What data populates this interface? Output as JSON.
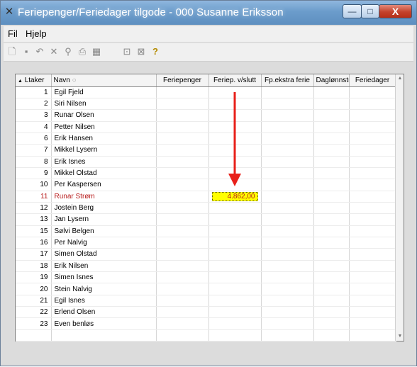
{
  "window": {
    "title": "Feriepenger/Feriedager tilgode - 000 Susanne Eriksson",
    "minimize": "—",
    "maximize": "□",
    "close": "X"
  },
  "menu": {
    "file": "Fil",
    "help": "Hjelp"
  },
  "toolbar": {
    "icons": [
      "new-icon",
      "save-icon",
      "undo-icon",
      "delete-icon",
      "find-icon",
      "print-icon",
      "calculator-icon",
      "export-icon",
      "excel-icon",
      "help-icon"
    ],
    "help_glyph": "?"
  },
  "grid": {
    "columns": [
      "Ltaker",
      "Navn",
      "Feriepenger",
      "Feriep. v/slutt",
      "Fp.ekstra ferie",
      "Daglønnstr",
      "Feriedager"
    ],
    "sort_indicator": "▲",
    "rows": [
      {
        "nr": "1",
        "name": "Egil Fjeld"
      },
      {
        "nr": "2",
        "name": "Siri Nilsen"
      },
      {
        "nr": "3",
        "name": "Runar Olsen"
      },
      {
        "nr": "4",
        "name": "Petter Nilsen"
      },
      {
        "nr": "6",
        "name": "Erik Hansen"
      },
      {
        "nr": "7",
        "name": "Mikkel Lysern"
      },
      {
        "nr": "8",
        "name": "Erik Isnes"
      },
      {
        "nr": "9",
        "name": "Mikkel Olstad"
      },
      {
        "nr": "10",
        "name": "Per Kaspersen"
      },
      {
        "nr": "11",
        "name": "Runar Strøm",
        "feriep_slutt": "4.862,00"
      },
      {
        "nr": "12",
        "name": "Jostein Berg"
      },
      {
        "nr": "13",
        "name": "Jan Lysern"
      },
      {
        "nr": "15",
        "name": "Sølvi Belgen"
      },
      {
        "nr": "16",
        "name": "Per Nalvig"
      },
      {
        "nr": "17",
        "name": "Simen Olstad"
      },
      {
        "nr": "18",
        "name": "Erik Nilsen"
      },
      {
        "nr": "19",
        "name": "Simen Isnes"
      },
      {
        "nr": "20",
        "name": "Stein Nalvig"
      },
      {
        "nr": "21",
        "name": "Egil Isnes"
      },
      {
        "nr": "22",
        "name": "Erlend Olsen"
      },
      {
        "nr": "23",
        "name": "Even benløs"
      }
    ],
    "selected_row": "11"
  },
  "colors": {
    "arrow": "#e8201a",
    "highlight": "#ffff00",
    "selected_text": "#b81d1d"
  }
}
